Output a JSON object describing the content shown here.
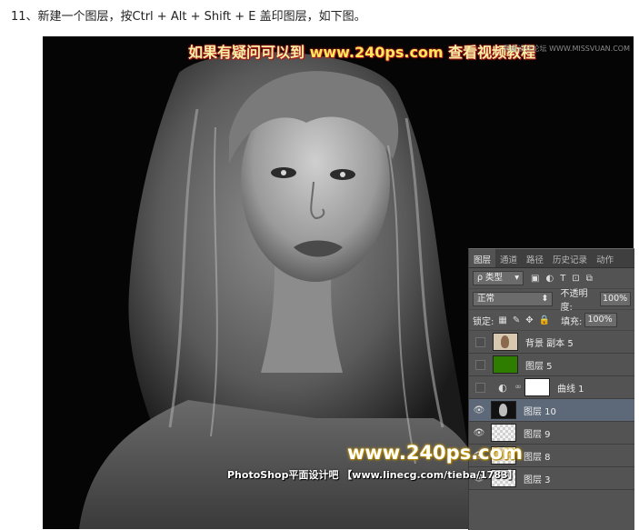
{
  "caption": "11、新建一个图层，按Ctrl + Alt + Shift + E 盖印图层，如下图。",
  "watermarks": {
    "top_prefix": "如果有疑问可以到",
    "top_url": "www.240ps.com",
    "top_suffix": "查看视频教程",
    "corner": "思缘设计论坛 WWW.MISSVUAN.COM",
    "middle": "www.240ps.com",
    "bottom": "PhotoShop平面设计吧 【www.linecg.com/tieba/1783】"
  },
  "panel": {
    "tabs": [
      "图层",
      "通道",
      "路径",
      "历史记录",
      "动作"
    ],
    "active_tab": "图层",
    "filter_label": "ρ 类型",
    "blend_mode": "正常",
    "opacity_label": "不透明度:",
    "opacity_value": "100%",
    "lock_label": "锁定:",
    "fill_label": "填充:",
    "fill_value": "100%",
    "layers": [
      {
        "name": "背景 副本 5",
        "visible": false,
        "thumb": "copy",
        "selected": false
      },
      {
        "name": "图层 5",
        "visible": false,
        "thumb": "green",
        "selected": false
      },
      {
        "name": "曲线 1",
        "visible": false,
        "thumb": "mask",
        "selected": false
      },
      {
        "name": "图层 10",
        "visible": true,
        "thumb": "portrait",
        "selected": true
      },
      {
        "name": "图层 9",
        "visible": true,
        "thumb": "transparent",
        "selected": false
      },
      {
        "name": "图层 8",
        "visible": true,
        "thumb": "transparent",
        "selected": false
      },
      {
        "name": "图层 3",
        "visible": true,
        "thumb": "transparent",
        "selected": false
      }
    ]
  },
  "icons": {
    "eye": "eye-icon",
    "curves": "curves-adjustment-icon",
    "chain": "link-icon"
  }
}
